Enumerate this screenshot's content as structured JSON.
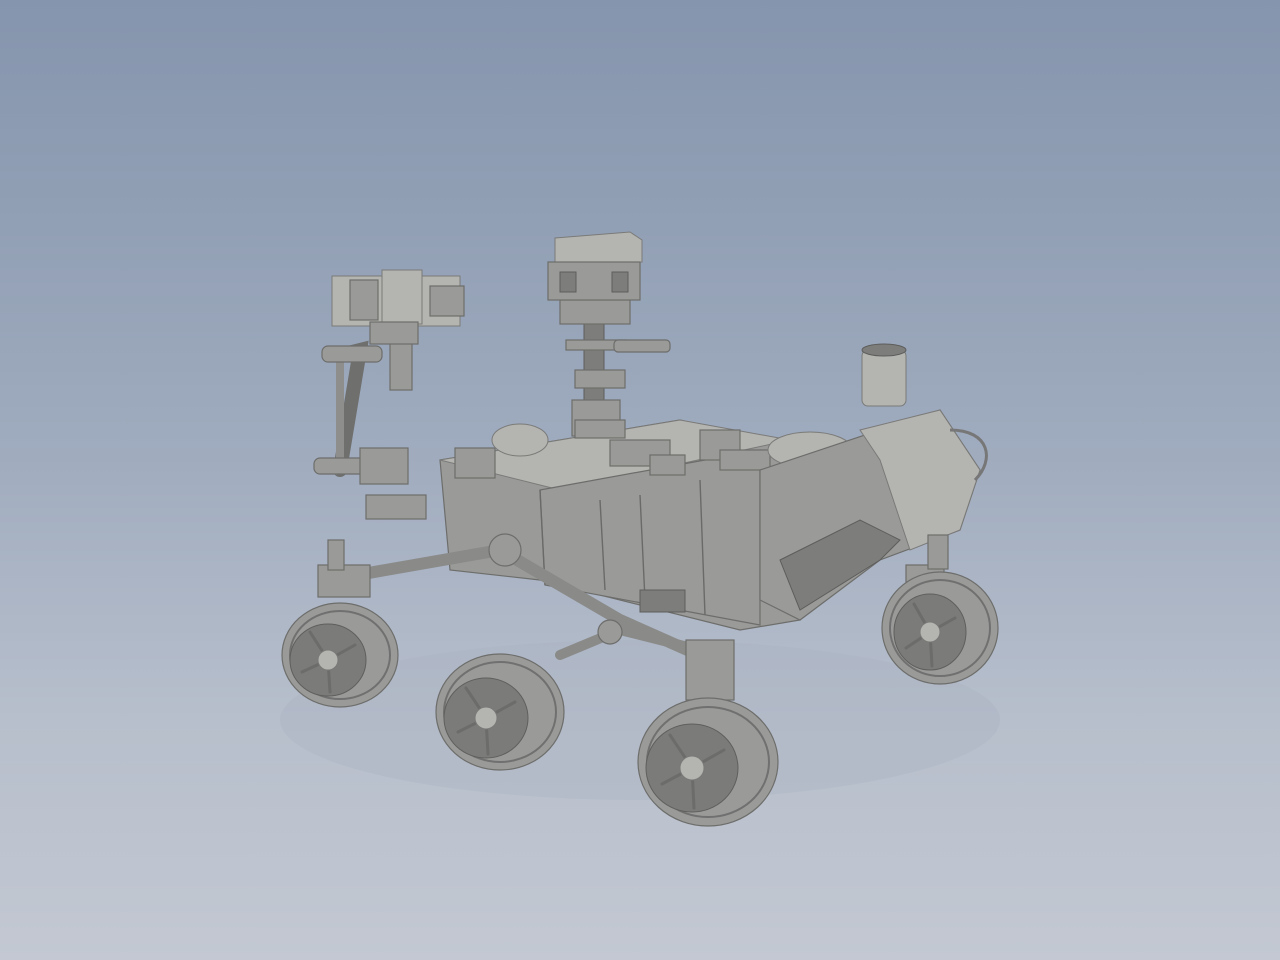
{
  "viewer": {
    "background_top": "#8595ad",
    "background_bottom": "#c3c8d2",
    "model_color": "#9a9a98"
  }
}
